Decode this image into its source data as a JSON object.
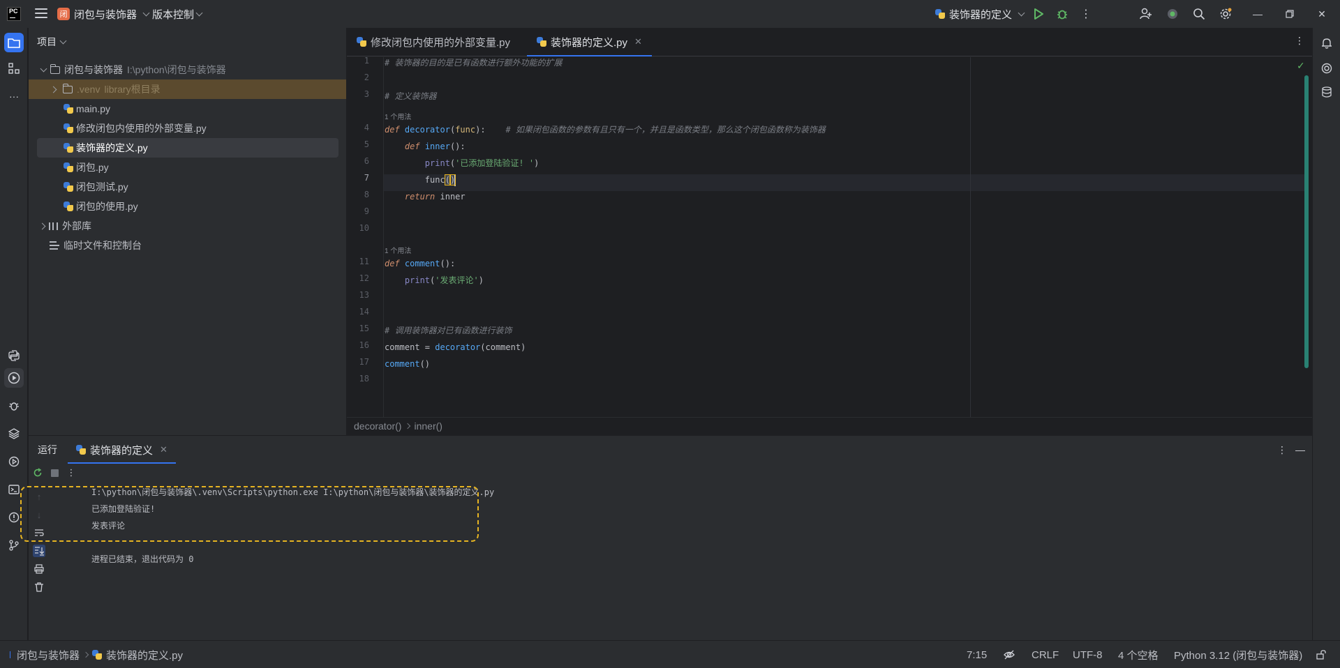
{
  "titlebar": {
    "project_badge": "闭",
    "project_name": "闭包与装饰器",
    "vcs_label": "版本控制",
    "run_config": "装饰器的定义"
  },
  "project_panel": {
    "header": "项目",
    "root_name": "闭包与装饰器",
    "root_path": "I:\\python\\闭包与装饰器",
    "venv_name": ".venv",
    "venv_hint": "library根目录",
    "files": [
      "main.py",
      "修改闭包内使用的外部变量.py",
      "装饰器的定义.py",
      "闭包.py",
      "闭包测试.py",
      "闭包的使用.py"
    ],
    "external_libs": "外部库",
    "scratches": "临时文件和控制台"
  },
  "editor": {
    "tabs": [
      {
        "label": "修改闭包内使用的外部变量.py"
      },
      {
        "label": "装饰器的定义.py"
      }
    ],
    "line_numbers": [
      "1",
      "2",
      "3",
      "4",
      "5",
      "6",
      "7",
      "8",
      "9",
      "10",
      "11",
      "12",
      "13",
      "14",
      "15",
      "16",
      "17",
      "18"
    ],
    "usages_label": "1 个用法",
    "code": {
      "l1": "# 装饰器的目的是已有函数进行额外功能的扩展",
      "l3": "# 定义装饰器",
      "l4_kw": "def",
      "l4_fn": "decorator",
      "l4_pa": "func",
      "l4_cm": "# 如果闭包函数的参数有且只有一个，并且是函数类型，那么这个闭包函数称为装饰器",
      "l5_kw": "def",
      "l5_fn": "inner",
      "l6_bi": "print",
      "l6_st": "'已添加登陆验证! '",
      "l7": "func",
      "l8_kw": "return",
      "l8_rest": "inner",
      "l11_kw": "def",
      "l11_fn": "comment",
      "l12_bi": "print",
      "l12_st": "'发表评论'",
      "l15": "# 调用装饰器对已有函数进行装饰",
      "l16_a": "comment = ",
      "l16_fn": "decorator",
      "l16_b": "(comment)",
      "l17_fn": "comment",
      "l17_b": "()"
    },
    "breadcrumbs": [
      "decorator()",
      "inner()"
    ]
  },
  "run_panel": {
    "title": "运行",
    "tab_label": "装饰器的定义",
    "console": [
      "I:\\python\\闭包与装饰器\\.venv\\Scripts\\python.exe I:\\python\\闭包与装饰器\\装饰器的定义.py",
      "已添加登陆验证!",
      "发表评论",
      "",
      "进程已结束，退出代码为 0"
    ]
  },
  "statusbar": {
    "crumbs": [
      "闭包与装饰器",
      "装饰器的定义.py"
    ],
    "position": "7:15",
    "line_sep": "CRLF",
    "encoding": "UTF-8",
    "indent": "4 个空格",
    "interpreter": "Python 3.12 (闭包与装饰器)"
  },
  "colors": {
    "accent": "#3574f0",
    "highlight_box": "#e6b422",
    "excluded_bg": "#5b4a2e"
  },
  "icons": [
    "menu-icon",
    "run-icon",
    "debug-icon",
    "more-icon",
    "add-user-icon",
    "record-icon",
    "search-icon",
    "settings-icon",
    "minimize-icon",
    "maximize-icon",
    "close-icon",
    "folder-icon",
    "python-file-icon",
    "rerun-icon",
    "stop-icon",
    "trash-icon",
    "print-icon",
    "wrap-icon"
  ]
}
